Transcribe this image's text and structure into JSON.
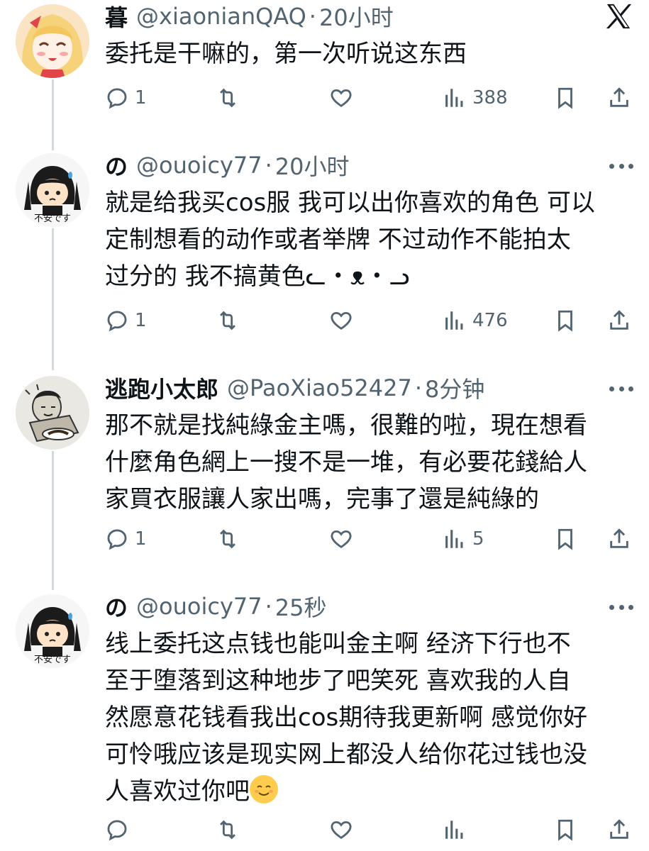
{
  "tweets": [
    {
      "name": "暮",
      "handle": "@xiaonianQAQ",
      "dot": "·",
      "time": "20小时",
      "lines": [
        "委托是干嘛的，第一次听说这东西"
      ],
      "replies": "1",
      "views": "388",
      "avatar_icon": "anime-girl-avatar"
    },
    {
      "name": "の",
      "handle": "@ouoicy77",
      "dot": "·",
      "time": "20小时",
      "lines": [
        "就是给我买cos服 我可以出你喜欢的角色 可以",
        "定制想看的动作或者举牌 不过动作不能拍太",
        "过分的 我不搞黄色ᓚ・ᴥ・ᓗ"
      ],
      "replies": "1",
      "views": "476",
      "avatar_icon": "chibi-avatar",
      "avatar_caption": "不安です"
    },
    {
      "name": "逃跑小太郎",
      "handle": "@PaoXiao52427",
      "dot": "·",
      "time": "8分钟",
      "lines": [
        "那不就是找純綠金主嗎，很難的啦，現在想看",
        "什麼角色網上一搜不是一堆，有必要花錢給人",
        "家買衣服讓人家出嗎，完事了還是純綠的"
      ],
      "replies": "1",
      "views": "5",
      "avatar_icon": "sketch-avatar"
    },
    {
      "name": "の",
      "handle": "@ouoicy77",
      "dot": "·",
      "time": "25秒",
      "lines": [
        "线上委托这点钱也能叫金主啊 经济下行也不",
        "至于堕落到这种地步了吧笑死 喜欢我的人自",
        "然愿意花钱看我出cos期待我更新啊 感觉你好",
        "可怜哦应该是现实网上都没人给你花过钱也没",
        "人喜欢过你吧"
      ],
      "replies": "",
      "views": "",
      "avatar_icon": "chibi-avatar",
      "avatar_caption": "不安です",
      "emoji": "smiling-face-emoji"
    }
  ],
  "colors": {
    "text": "#0f1419",
    "secondary": "#536471",
    "line": "#cfd9de"
  }
}
